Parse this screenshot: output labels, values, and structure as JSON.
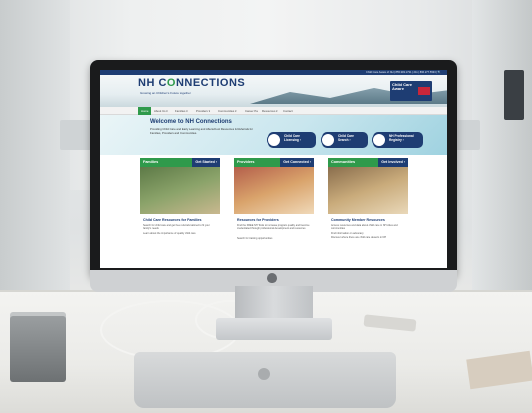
{
  "site": {
    "logo_prefix": "NH C",
    "logo_o": "O",
    "logo_suffix": "NNECTIONS",
    "tagline": "Growing an Children's Future together",
    "utility_bar": "Child Care Aware of NH | 855.393.1731 | 211 | 866.277.5533 | 🔍",
    "ccaware_label": "Child Care Aware"
  },
  "nav": {
    "items": [
      "Home",
      "About Us ▾",
      "Families ▾",
      "Providers ▾",
      "Communities ▾",
      "Career Pa",
      "Resources ▾",
      "Contact"
    ]
  },
  "hero": {
    "title": "Welcome to NH Connections",
    "body": "Providing Child Care and Early Learning and Afterschool Resources & Referrals for Families, Providers and Communities.",
    "quick_links": [
      {
        "label_line1": "Child Care",
        "label_line2": "Licensing ›",
        "icon": "checkmark-icon"
      },
      {
        "label_line1": "Child Care",
        "label_line2": "Search ›",
        "icon": "location-pin-icon"
      },
      {
        "label_line1": "NH Professional",
        "label_line2": "Registry ›",
        "icon": "star-badge-icon"
      }
    ]
  },
  "cards": [
    {
      "header": "Families",
      "cta": "Get Started ›",
      "title": "Child Care Resources for Families",
      "bullets": [
        "Search for child care and get free referrals tailored to fit your family's needs",
        "Learn about the importance of quality child care"
      ],
      "photo_colors": [
        "#5d7a47",
        "#8ba36a",
        "#c9b88f"
      ]
    },
    {
      "header": "Providers",
      "cta": "Get Connected ›",
      "title": "Resources for Providers",
      "bullets": [
        "Find the FREE NH Tools to increase program quality and become credentialed through professional development and resources",
        "Search for training opportunities"
      ],
      "photo_colors": [
        "#b45f4b",
        "#d9a36b",
        "#f0d9b9"
      ]
    },
    {
      "header": "Communities",
      "cta": "Get Involved ›",
      "title": "Community Member Resources",
      "bullets": [
        "Access resources and data about child care in NH cities and communities",
        "Find information on advocacy",
        "Discover where there are child care deserts in NH"
      ],
      "photo_colors": [
        "#8a6e4d",
        "#c9ab7b",
        "#e9d8b9"
      ]
    }
  ],
  "colors": {
    "navy": "#1e3d73",
    "green": "#2f9a4b",
    "bezel": "#1a1b1c"
  }
}
